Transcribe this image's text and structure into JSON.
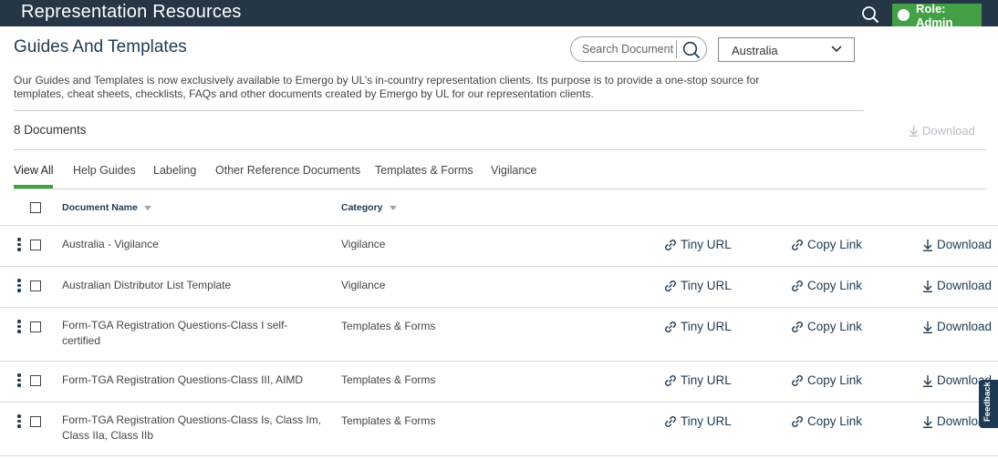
{
  "header": {
    "app_title": "Representation Resources",
    "role_label": "Role: Admin",
    "colors": {
      "bar": "#253746",
      "role": "#43a047"
    }
  },
  "page": {
    "title": "Guides And Templates",
    "search_placeholder": "Search Document",
    "country": "Australia",
    "intro": "Our Guides and Templates is now exclusively available to Emergo by UL’s in-country representation clients. Its purpose is to provide a one-stop source for templates, cheat sheets, checklists, FAQs and other documents created by Emergo by UL for our representation clients.",
    "doc_count": "8 Documents",
    "download_all": "Download"
  },
  "tabs": [
    {
      "label": "View All",
      "active": true
    },
    {
      "label": "Help Guides"
    },
    {
      "label": "Labeling"
    },
    {
      "label": "Other Reference Documents"
    },
    {
      "label": "Templates & Forms"
    },
    {
      "label": "Vigilance"
    }
  ],
  "table": {
    "col_name": "Document Name",
    "col_category": "Category",
    "action_tiny": "Tiny URL",
    "action_copy": "Copy Link",
    "action_download": "Download",
    "rows": [
      {
        "name": "Australia - Vigilance",
        "category": "Vigilance"
      },
      {
        "name": "Australian Distributor List Template",
        "category": "Vigilance"
      },
      {
        "name": "Form-TGA Registration Questions-Class I self-certified",
        "category": "Templates & Forms"
      },
      {
        "name": "Form-TGA Registration Questions-Class III, AIMD",
        "category": "Templates & Forms"
      },
      {
        "name": "Form-TGA Registration Questions-Class Is, Class Im, Class IIa, Class IIb",
        "category": "Templates & Forms"
      }
    ]
  },
  "feedback_label": "Feedback"
}
